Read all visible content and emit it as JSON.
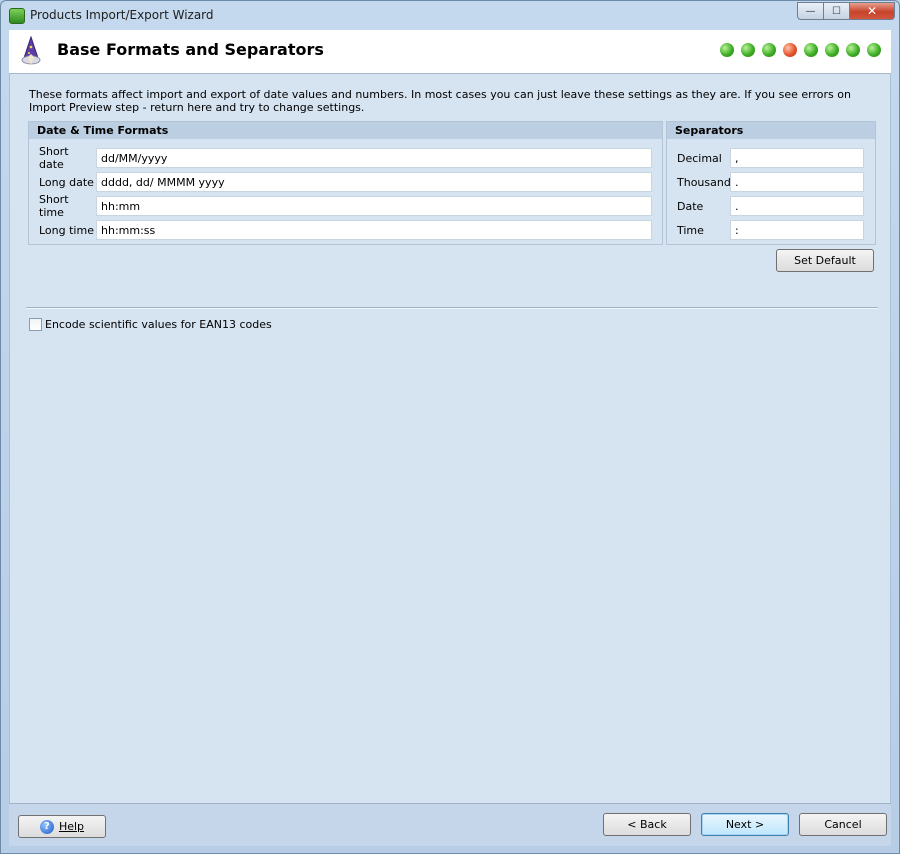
{
  "window": {
    "title": "Products Import/Export Wizard",
    "buttons": {
      "minimize": "—",
      "maximize": "☐",
      "close": "✕"
    }
  },
  "header": {
    "title": "Base Formats and Separators",
    "step_count": 8,
    "active_step": 4
  },
  "intro": "These formats affect import and export of date values and numbers. In most cases you can just leave these settings as they are. If you see errors on Import Preview step - return here and try to change settings.",
  "datetime": {
    "heading": "Date & Time Formats",
    "fields": [
      {
        "label": "Short date",
        "value": "dd/MM/yyyy"
      },
      {
        "label": "Long date",
        "value": "dddd, dd/ MMMM yyyy"
      },
      {
        "label": "Short time",
        "value": "hh:mm"
      },
      {
        "label": "Long time",
        "value": "hh:mm:ss"
      }
    ]
  },
  "separators": {
    "heading": "Separators",
    "fields": [
      {
        "label": "Decimal",
        "value": ","
      },
      {
        "label": "Thousand",
        "value": "."
      },
      {
        "label": "Date",
        "value": "."
      },
      {
        "label": "Time",
        "value": ":"
      }
    ]
  },
  "set_default_label": "Set Default",
  "encode_checkbox": {
    "label": "Encode scientific values for EAN13 codes",
    "checked": false
  },
  "footer": {
    "help_label": "Help",
    "back_label": "< Back",
    "next_label": "Next >",
    "cancel_label": "Cancel"
  },
  "colors": {
    "active_step": "#e5542e",
    "step": "#3fae25",
    "background": "#d6e3f1"
  },
  "icons": [
    "app-icon",
    "wizard-icon",
    "help-icon"
  ]
}
